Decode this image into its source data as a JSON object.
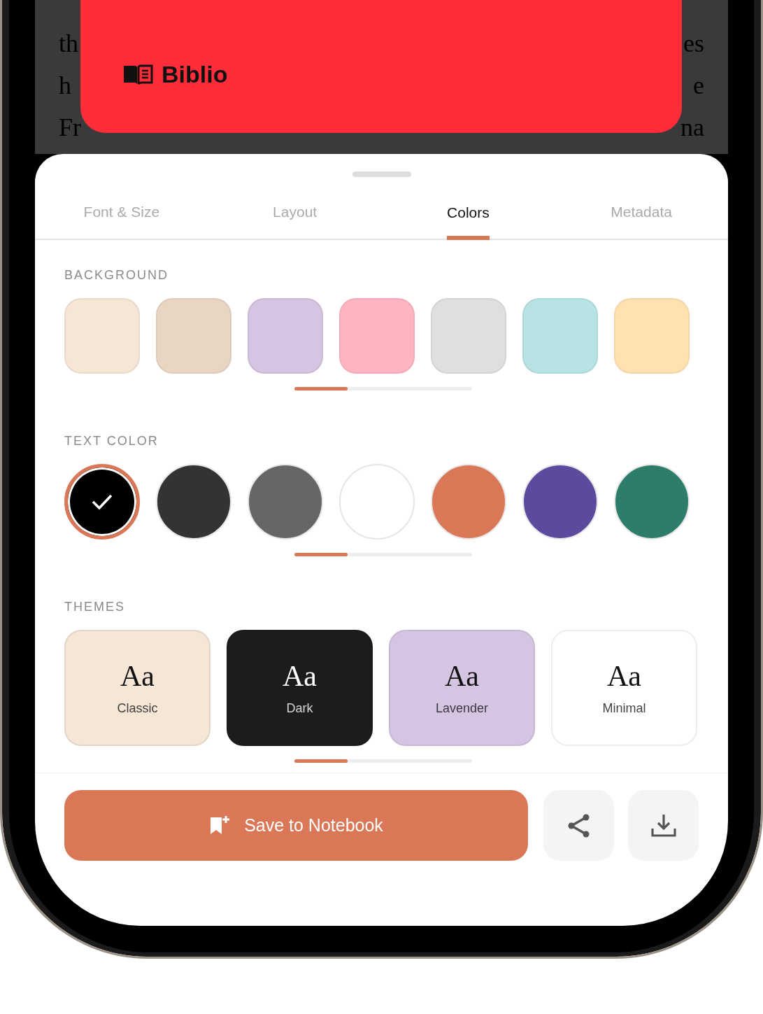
{
  "reader_text": [
    {
      "left": "th",
      "right": "es"
    },
    {
      "left": "h",
      "right": "e"
    },
    {
      "left": "Fr",
      "right": "na"
    }
  ],
  "banner": {
    "title": "Biblio"
  },
  "tabs": [
    {
      "label": "Font & Size",
      "selected": false
    },
    {
      "label": "Layout",
      "selected": false
    },
    {
      "label": "Colors",
      "selected": true
    },
    {
      "label": "Metadata",
      "selected": false
    }
  ],
  "background": {
    "label": "BACKGROUND",
    "swatches": [
      {
        "color": "#f5e6d6"
      },
      {
        "color": "#e8d5c4"
      },
      {
        "color": "#d5c5e2"
      },
      {
        "color": "#ffb5c0"
      },
      {
        "color": "#dfdfdf"
      },
      {
        "color": "#b7e3e4"
      },
      {
        "color": "#ffe2b0"
      }
    ]
  },
  "text_color": {
    "label": "TEXT COLOR",
    "swatches": [
      {
        "color": "#000000",
        "selected": true
      },
      {
        "color": "#333333",
        "selected": false
      },
      {
        "color": "#666666",
        "selected": false
      },
      {
        "color": "#ffffff",
        "selected": false
      },
      {
        "color": "#d97757",
        "selected": false
      },
      {
        "color": "#5b4a9e",
        "selected": false
      },
      {
        "color": "#2e7d6a",
        "selected": false
      }
    ]
  },
  "themes": {
    "label": "THEMES",
    "items": [
      {
        "sample": "Aa",
        "name": "Classic",
        "color": "#f5e6d6"
      },
      {
        "sample": "Aa",
        "name": "Dark",
        "color": "#1c1c1e"
      },
      {
        "sample": "Aa",
        "name": "Lavender",
        "color": "#d5c5e2"
      },
      {
        "sample": "Aa",
        "name": "Minimal",
        "color": "#ffffff"
      }
    ]
  },
  "actions": {
    "primary": "Save to Notebook"
  }
}
